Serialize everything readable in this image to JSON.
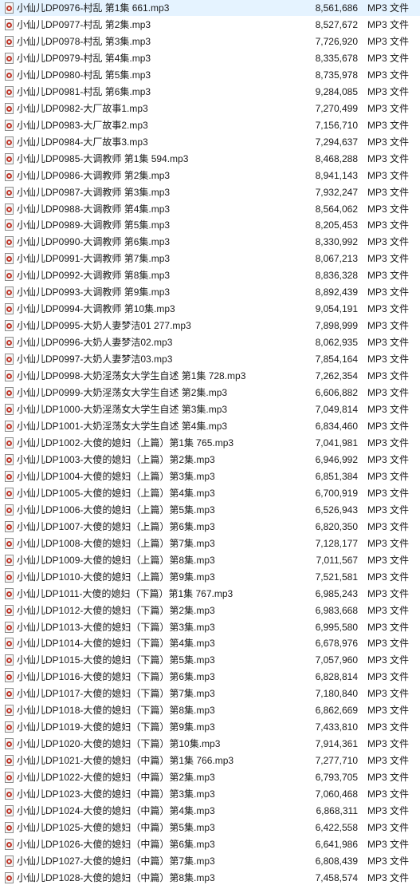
{
  "file_list": {
    "rows": [
      {
        "name": "小仙儿DP0976-村乱 第1集 661.mp3",
        "size": "8,561,686",
        "type": "MP3 文件"
      },
      {
        "name": "小仙儿DP0977-村乱 第2集.mp3",
        "size": "8,527,672",
        "type": "MP3 文件"
      },
      {
        "name": "小仙儿DP0978-村乱 第3集.mp3",
        "size": "7,726,920",
        "type": "MP3 文件"
      },
      {
        "name": "小仙儿DP0979-村乱 第4集.mp3",
        "size": "8,335,678",
        "type": "MP3 文件"
      },
      {
        "name": "小仙儿DP0980-村乱 第5集.mp3",
        "size": "8,735,978",
        "type": "MP3 文件"
      },
      {
        "name": "小仙儿DP0981-村乱 第6集.mp3",
        "size": "9,284,085",
        "type": "MP3 文件"
      },
      {
        "name": "小仙儿DP0982-大厂故事1.mp3",
        "size": "7,270,499",
        "type": "MP3 文件"
      },
      {
        "name": "小仙儿DP0983-大厂故事2.mp3",
        "size": "7,156,710",
        "type": "MP3 文件"
      },
      {
        "name": "小仙儿DP0984-大厂故事3.mp3",
        "size": "7,294,637",
        "type": "MP3 文件"
      },
      {
        "name": "小仙儿DP0985-大调教师 第1集 594.mp3",
        "size": "8,468,288",
        "type": "MP3 文件"
      },
      {
        "name": "小仙儿DP0986-大调教师 第2集.mp3",
        "size": "8,941,143",
        "type": "MP3 文件"
      },
      {
        "name": "小仙儿DP0987-大调教师 第3集.mp3",
        "size": "7,932,247",
        "type": "MP3 文件"
      },
      {
        "name": "小仙儿DP0988-大调教师 第4集.mp3",
        "size": "8,564,062",
        "type": "MP3 文件"
      },
      {
        "name": "小仙儿DP0989-大调教师 第5集.mp3",
        "size": "8,205,453",
        "type": "MP3 文件"
      },
      {
        "name": "小仙儿DP0990-大调教师 第6集.mp3",
        "size": "8,330,992",
        "type": "MP3 文件"
      },
      {
        "name": "小仙儿DP0991-大调教师 第7集.mp3",
        "size": "8,067,213",
        "type": "MP3 文件"
      },
      {
        "name": "小仙儿DP0992-大调教师 第8集.mp3",
        "size": "8,836,328",
        "type": "MP3 文件"
      },
      {
        "name": "小仙儿DP0993-大调教师 第9集.mp3",
        "size": "8,892,439",
        "type": "MP3 文件"
      },
      {
        "name": "小仙儿DP0994-大调教师 第10集.mp3",
        "size": "9,054,191",
        "type": "MP3 文件"
      },
      {
        "name": "小仙儿DP0995-大奶人妻梦洁01 277.mp3",
        "size": "7,898,999",
        "type": "MP3 文件"
      },
      {
        "name": "小仙儿DP0996-大奶人妻梦洁02.mp3",
        "size": "8,062,935",
        "type": "MP3 文件"
      },
      {
        "name": "小仙儿DP0997-大奶人妻梦洁03.mp3",
        "size": "7,854,164",
        "type": "MP3 文件"
      },
      {
        "name": "小仙儿DP0998-大奶淫荡女大学生自述 第1集 728.mp3",
        "size": "7,262,354",
        "type": "MP3 文件"
      },
      {
        "name": "小仙儿DP0999-大奶淫荡女大学生自述 第2集.mp3",
        "size": "6,606,882",
        "type": "MP3 文件"
      },
      {
        "name": "小仙儿DP1000-大奶淫荡女大学生自述 第3集.mp3",
        "size": "7,049,814",
        "type": "MP3 文件"
      },
      {
        "name": "小仙儿DP1001-大奶淫荡女大学生自述 第4集.mp3",
        "size": "6,834,460",
        "type": "MP3 文件"
      },
      {
        "name": "小仙儿DP1002-大傻的媳妇（上篇）第1集 765.mp3",
        "size": "7,041,981",
        "type": "MP3 文件"
      },
      {
        "name": "小仙儿DP1003-大傻的媳妇（上篇）第2集.mp3",
        "size": "6,946,992",
        "type": "MP3 文件"
      },
      {
        "name": "小仙儿DP1004-大傻的媳妇（上篇）第3集.mp3",
        "size": "6,851,384",
        "type": "MP3 文件"
      },
      {
        "name": "小仙儿DP1005-大傻的媳妇（上篇）第4集.mp3",
        "size": "6,700,919",
        "type": "MP3 文件"
      },
      {
        "name": "小仙儿DP1006-大傻的媳妇（上篇）第5集.mp3",
        "size": "6,526,943",
        "type": "MP3 文件"
      },
      {
        "name": "小仙儿DP1007-大傻的媳妇（上篇）第6集.mp3",
        "size": "6,820,350",
        "type": "MP3 文件"
      },
      {
        "name": "小仙儿DP1008-大傻的媳妇（上篇）第7集.mp3",
        "size": "7,128,177",
        "type": "MP3 文件"
      },
      {
        "name": "小仙儿DP1009-大傻的媳妇（上篇）第8集.mp3",
        "size": "7,011,567",
        "type": "MP3 文件"
      },
      {
        "name": "小仙儿DP1010-大傻的媳妇（上篇）第9集.mp3",
        "size": "7,521,581",
        "type": "MP3 文件"
      },
      {
        "name": "小仙儿DP1011-大傻的媳妇（下篇）第1集 767.mp3",
        "size": "6,985,243",
        "type": "MP3 文件"
      },
      {
        "name": "小仙儿DP1012-大傻的媳妇（下篇）第2集.mp3",
        "size": "6,983,668",
        "type": "MP3 文件"
      },
      {
        "name": "小仙儿DP1013-大傻的媳妇（下篇）第3集.mp3",
        "size": "6,995,580",
        "type": "MP3 文件"
      },
      {
        "name": "小仙儿DP1014-大傻的媳妇（下篇）第4集.mp3",
        "size": "6,678,976",
        "type": "MP3 文件"
      },
      {
        "name": "小仙儿DP1015-大傻的媳妇（下篇）第5集.mp3",
        "size": "7,057,960",
        "type": "MP3 文件"
      },
      {
        "name": "小仙儿DP1016-大傻的媳妇（下篇）第6集.mp3",
        "size": "6,828,814",
        "type": "MP3 文件"
      },
      {
        "name": "小仙儿DP1017-大傻的媳妇（下篇）第7集.mp3",
        "size": "7,180,840",
        "type": "MP3 文件"
      },
      {
        "name": "小仙儿DP1018-大傻的媳妇（下篇）第8集.mp3",
        "size": "6,862,669",
        "type": "MP3 文件"
      },
      {
        "name": "小仙儿DP1019-大傻的媳妇（下篇）第9集.mp3",
        "size": "7,433,810",
        "type": "MP3 文件"
      },
      {
        "name": "小仙儿DP1020-大傻的媳妇（下篇）第10集.mp3",
        "size": "7,914,361",
        "type": "MP3 文件"
      },
      {
        "name": "小仙儿DP1021-大傻的媳妇（中篇）第1集 766.mp3",
        "size": "7,277,710",
        "type": "MP3 文件"
      },
      {
        "name": "小仙儿DP1022-大傻的媳妇（中篇）第2集.mp3",
        "size": "6,793,705",
        "type": "MP3 文件"
      },
      {
        "name": "小仙儿DP1023-大傻的媳妇（中篇）第3集.mp3",
        "size": "7,060,468",
        "type": "MP3 文件"
      },
      {
        "name": "小仙儿DP1024-大傻的媳妇（中篇）第4集.mp3",
        "size": "6,868,311",
        "type": "MP3 文件"
      },
      {
        "name": "小仙儿DP1025-大傻的媳妇（中篇）第5集.mp3",
        "size": "6,422,558",
        "type": "MP3 文件"
      },
      {
        "name": "小仙儿DP1026-大傻的媳妇（中篇）第6集.mp3",
        "size": "6,641,986",
        "type": "MP3 文件"
      },
      {
        "name": "小仙儿DP1027-大傻的媳妇（中篇）第7集.mp3",
        "size": "6,808,439",
        "type": "MP3 文件"
      },
      {
        "name": "小仙儿DP1028-大傻的媳妇（中篇）第8集.mp3",
        "size": "7,458,574",
        "type": "MP3 文件"
      }
    ],
    "file_icon": "mp3-file-icon"
  }
}
